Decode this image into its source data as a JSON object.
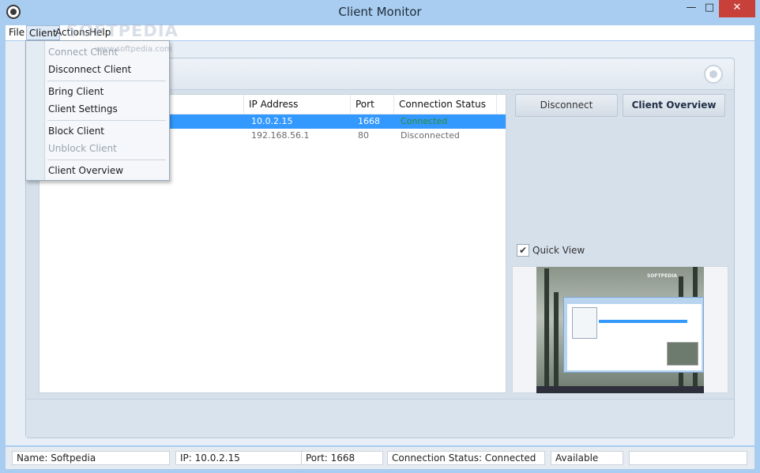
{
  "window": {
    "title": "Client Monitor",
    "controls": {
      "minimize": "—",
      "maximize": "□",
      "close": "✕"
    }
  },
  "menubar": {
    "items": [
      "File",
      "Client",
      "Actions",
      "Help"
    ]
  },
  "watermark": {
    "text": "SOFTPEDIA",
    "url": "www.softpedia.com"
  },
  "client_menu": {
    "items": [
      {
        "label": "Connect Client",
        "enabled": false
      },
      {
        "label": "Disconnect Client",
        "enabled": true
      },
      {
        "label": "Bring Client",
        "enabled": true
      },
      {
        "label": "Client Settings",
        "enabled": true
      },
      {
        "label": "Block Client",
        "enabled": true
      },
      {
        "label": "Unblock Client",
        "enabled": false
      },
      {
        "label": "Client Overview",
        "enabled": true
      }
    ]
  },
  "client_list": {
    "columns": [
      "IP Address",
      "Port",
      "Connection Status"
    ],
    "rows": [
      {
        "ip": "10.0.2.15",
        "port": "1668",
        "status": "Connected",
        "selected": true
      },
      {
        "ip": "192.168.56.1",
        "port": "80",
        "status": "Disconnected",
        "selected": false
      }
    ]
  },
  "actions": {
    "disconnect_label": "Disconnect",
    "overview_label": "Client Overview"
  },
  "quick_view": {
    "label": "Quick View",
    "checked": true,
    "check_glyph": "✔"
  },
  "statusbar": {
    "name": "Name: Softpedia",
    "ip": "IP: 10.0.2.15",
    "port": "Port: 1668",
    "connection": "Connection Status: Connected",
    "availability": "Available",
    "extra": ""
  },
  "colors": {
    "selection": "#3399ff",
    "connected": "#2e8b2e",
    "close_button": "#c7413a"
  }
}
